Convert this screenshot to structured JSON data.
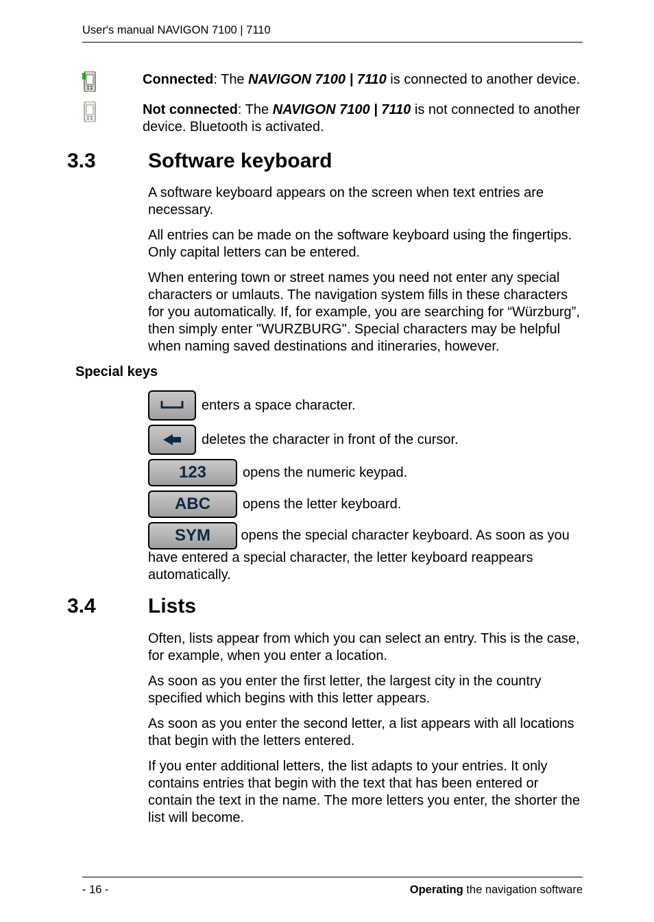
{
  "header": {
    "text": "User's manual NAVIGON 7100 | 7110"
  },
  "status": {
    "connected": {
      "label": "Connected",
      "sep": ": The ",
      "product": "NAVIGON 7100 | 7110",
      "rest": " is connected to another device."
    },
    "not_connected": {
      "label": "Not connected",
      "sep": ": The ",
      "product": "NAVIGON 7100 | 7110",
      "rest": " is not connected to another device. Bluetooth is activated."
    }
  },
  "sections": {
    "s33": {
      "num": "3.3",
      "title": "Software keyboard",
      "p1": "A software keyboard appears on the screen when text entries are necessary.",
      "p2": "All entries can be made on the software keyboard using the fingertips. Only capital letters can be entered.",
      "p3": "When entering town or street names you need not enter any special characters or umlauts. The navigation system fills in these characters for you automatically. If, for example, you are searching for “Würzburg”, then simply enter \"WURZBURG\". Special characters may be helpful when naming saved destinations and itineraries, however.",
      "special_keys_heading": "Special keys",
      "keys": {
        "space": {
          "desc": " enters a space character."
        },
        "backspace": {
          "desc": " deletes the character in front of the cursor."
        },
        "numeric": {
          "label": "123",
          "desc": " opens the numeric keypad."
        },
        "letters": {
          "label": "ABC",
          "desc": " opens the letter keyboard."
        },
        "symbols": {
          "label": "SYM",
          "desc": " opens the special character keyboard. As soon as you have entered a special character, the letter keyboard reappears automatically."
        }
      }
    },
    "s34": {
      "num": "3.4",
      "title": "Lists",
      "p1": "Often, lists appear from which you can select an entry. This is the case, for example, when you enter a location.",
      "p2": "As soon as you enter the first letter, the largest city in the country specified which begins with this letter appears.",
      "p3": "As soon as you enter the second letter, a list appears with all locations that begin with the letters entered.",
      "p4": "If you enter additional letters, the list adapts to your entries. It only contains entries that begin with the text that has been entered or contain the text in the name. The more letters you enter, the shorter the list will become."
    }
  },
  "footer": {
    "page_num": "- 16 -",
    "right_bold": "Operating",
    "right_rest": " the navigation software"
  }
}
